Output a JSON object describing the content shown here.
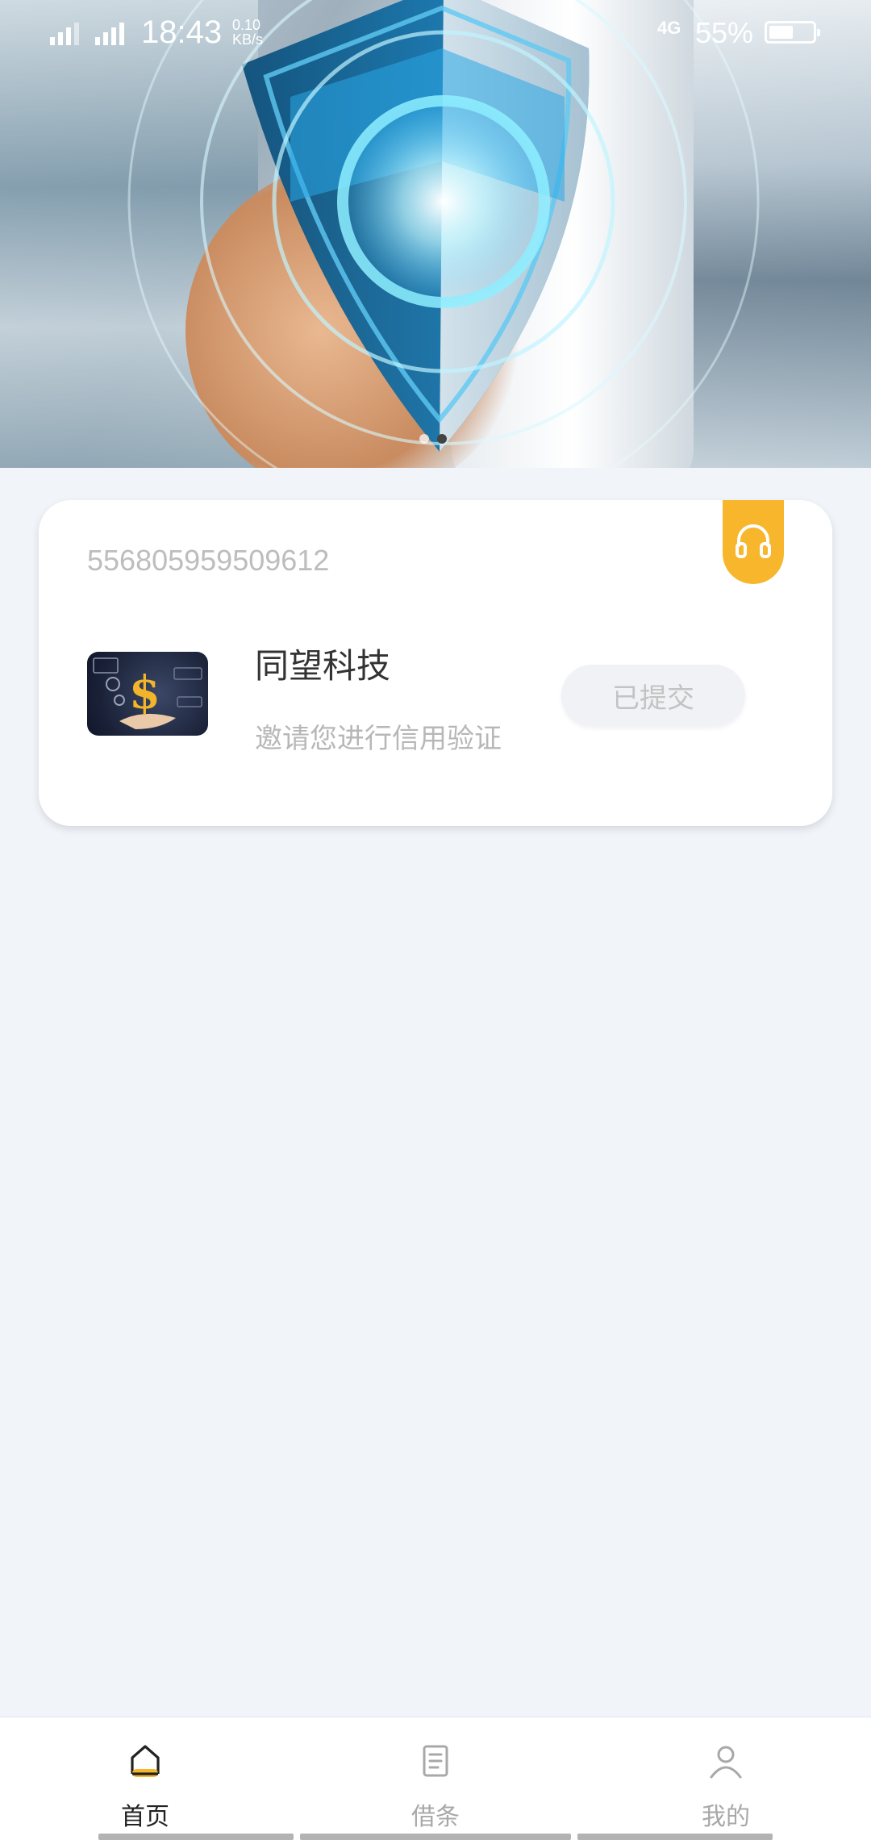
{
  "status_bar": {
    "time": "18:43",
    "net_speed_value": "0.10",
    "net_speed_unit": "KB/s",
    "network_type": "4G",
    "battery_percent_label": "55%",
    "battery_level": 0.55
  },
  "banner": {
    "slide_count": 2,
    "active_slide": 2
  },
  "card": {
    "id_number": "556805959509612",
    "title": "同望科技",
    "subtitle": "邀请您进行信用验证",
    "status_button": "已提交",
    "support_icon": "headset-icon",
    "accent_color": "#f8b62c"
  },
  "bottom_nav": {
    "items": [
      {
        "label": "首页",
        "icon": "home-icon",
        "active": true
      },
      {
        "label": "借条",
        "icon": "document-icon",
        "active": false
      },
      {
        "label": "我的",
        "icon": "user-icon",
        "active": false
      }
    ]
  }
}
